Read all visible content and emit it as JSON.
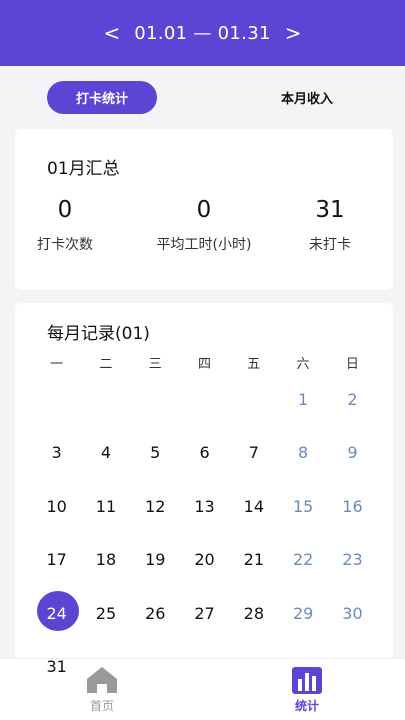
{
  "header": {
    "prev": "<",
    "next": ">",
    "date_range": "01.01 — 01.31"
  },
  "tabs": {
    "active": "打卡统计",
    "inactive": "本月收入"
  },
  "summary": {
    "title": "01月汇总",
    "stats": [
      {
        "value": "0",
        "label": "打卡次数"
      },
      {
        "value": "0",
        "label": "平均工时(小时)"
      },
      {
        "value": "31",
        "label": "未打卡"
      }
    ]
  },
  "calendar": {
    "title": "每月记录(01)",
    "weekdays": [
      "一",
      "二",
      "三",
      "四",
      "五",
      "六",
      "日"
    ],
    "first_weekday_index": 5,
    "days_in_month": 31,
    "today": 24,
    "weekend_color": "#6b8bbb",
    "accent_color": "#5b45d4"
  },
  "bottom_nav": {
    "home": {
      "label": "首页",
      "icon": "home-icon"
    },
    "stats": {
      "label": "统计",
      "icon": "bar-chart-icon"
    }
  }
}
